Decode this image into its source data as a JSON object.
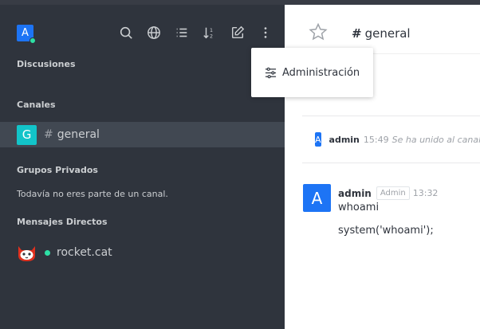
{
  "sidebar": {
    "user_avatar_letter": "A",
    "icons": [
      "search-icon",
      "directory-icon",
      "view-mode-icon",
      "sort-icon",
      "create-new-icon",
      "kebab-menu-icon"
    ],
    "sections": {
      "discussions": "Discusiones",
      "channels": "Canales",
      "private_groups": "Grupos Privados",
      "direct_messages": "Mensajes Directos"
    },
    "channel": {
      "avatar_letter": "G",
      "hash": "#",
      "name": "general"
    },
    "private_groups_empty": "Todavía no eres parte de un canal.",
    "direct_message": {
      "name": "rocket.cat"
    }
  },
  "header": {
    "hash": "#",
    "room_name": "general"
  },
  "menu": {
    "item_label": "Administración"
  },
  "messages": {
    "system": {
      "avatar_letter": "A",
      "user": "admin",
      "time": "15:49",
      "text": "Se ha unido al canal."
    },
    "post": {
      "avatar_letter": "A",
      "user": "admin",
      "role": "Admin",
      "time": "13:32",
      "line1": "whoami",
      "line2": "system('whoami');"
    }
  },
  "colors": {
    "sidebar_bg": "#2f343d",
    "active_row": "#414852",
    "avatar_blue": "#1d74f5",
    "channel_teal": "#12c4c9",
    "online_green": "#2de0a5"
  }
}
